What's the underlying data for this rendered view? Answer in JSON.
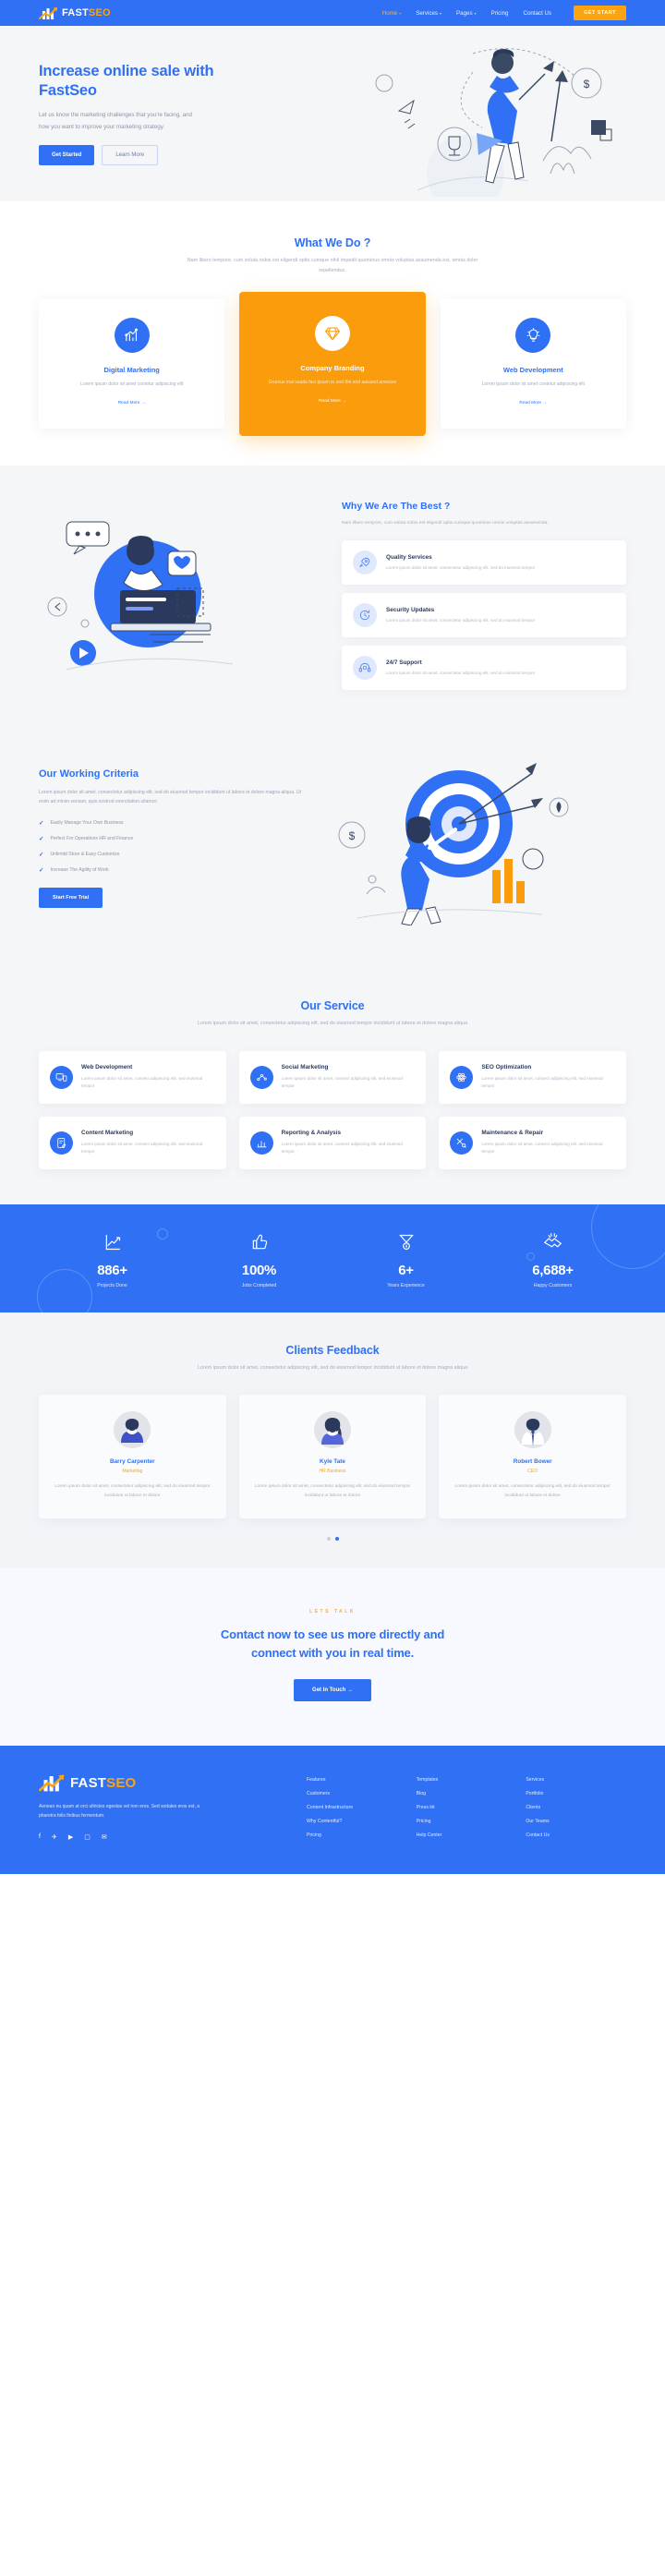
{
  "brand": {
    "name_white": "FAST",
    "name_orange": "SEO",
    "logo_icon": "bar-chart-arrow-logo"
  },
  "header": {
    "nav": [
      {
        "label": "Home",
        "has_caret": true,
        "active": true
      },
      {
        "label": "Services",
        "has_caret": true,
        "active": false
      },
      {
        "label": "Pages",
        "has_caret": true,
        "active": false
      },
      {
        "label": "Pricing",
        "has_caret": false,
        "active": false
      },
      {
        "label": "Contact Us",
        "has_caret": false,
        "active": false
      }
    ],
    "cta_label": "GET START"
  },
  "hero": {
    "title": "Increase online sale with FastSeo",
    "subtitle": "Let us know the marketing challenges that you're facing, and how you want to improve your marketing strategy.",
    "primary_btn": "Get Started",
    "secondary_btn": "Learn More"
  },
  "whatwedo": {
    "title": "What We Do ?",
    "subtitle": "Nam libero tempore, cum soluta nobis est eligendi optio cumque nihil impedit quominus omnis voluptas assumenda est, omnis dolor repellendus.",
    "cards": [
      {
        "icon": "bar-chart-icon",
        "title": "Digital Marketing",
        "desc": "Lorem ipsum dolor sit amet contetur adipiscing elit",
        "more": "Read More",
        "featured": false
      },
      {
        "icon": "diamond-icon",
        "title": "Company Branding",
        "desc": "Grurcus mal suada faci ipsum to and the and aaisand amesion",
        "more": "Read More",
        "featured": true
      },
      {
        "icon": "lightbulb-icon",
        "title": "Web Development",
        "desc": "Lorem ipsum dolor sit amet contetur adipiscing elit",
        "more": "Read More",
        "featured": false
      }
    ]
  },
  "whybest": {
    "title": "Why We Are The Best ?",
    "subtitle": "Nam libero tempore, cum soluta nobis est eligendi optio cumque quominus omnis voluptas assumenda.",
    "items": [
      {
        "icon": "rocket-icon",
        "title": "Quality Services",
        "desc": "Lorem ipsum dolor sit amet, consectetur adipiscing elit, sed do eiusmod tempor"
      },
      {
        "icon": "shield-refresh-icon",
        "title": "Security Updates",
        "desc": "Lorem ipsum dolor sit amet, consectetur adipiscing elit, sed do eiusmod tempor"
      },
      {
        "icon": "headset-support-icon",
        "title": "24/7 Support",
        "desc": "Lorem ipsum dolor sit amet, consectetur adipiscing elit, sed do eiusmod tempor"
      }
    ]
  },
  "criteria": {
    "title": "Our Working Criteria",
    "paragraph": "Lorem ipsum dolor sit amet, consectetur adipiscing elit, sed do eiusmod tempor incididunt ut labore et dolore magna aliqua. Ut enim ad minim veniam, quis nostrud exercitation ullamco",
    "bullets": [
      "Easily Manage Your Own Business",
      "Perfect For Operations HR and Finance",
      "Unlimitd Store & Easy Customize",
      "Increase The Agility of Work"
    ],
    "button": "Start Free Trial"
  },
  "ourservice": {
    "title": "Our Service",
    "subtitle": "Lorem ipsum dolor sit amet, consectetur adipiscing elit, sed do eiusmod tempor incididunt ut labore et dolore magna aliqua",
    "cards": [
      {
        "icon": "devices-icon",
        "title": "Web Development",
        "desc": "Lorem ipsum dolor sit amet, consect adipiscing elit, sed eiusmod tempor"
      },
      {
        "icon": "share-network-icon",
        "title": "Social Marketing",
        "desc": "Lorem ipsum dolor sit amet, consect adipiscing elit, sed eiusmod tempor"
      },
      {
        "icon": "atom-icon",
        "title": "SEO Optimization",
        "desc": "Lorem ipsum dolor sit amet, consect adipiscing elit, sed eiusmod tempor"
      },
      {
        "icon": "document-edit-icon",
        "title": "Content Marketing",
        "desc": "Lorem ipsum dolor sit amet, consect adipiscing elit, sed eiusmod tempor"
      },
      {
        "icon": "bar-report-icon",
        "title": "Reporting & Analysis",
        "desc": "Lorem ipsum dolor sit amet, consect adipiscing elit, sed eiusmod tempor"
      },
      {
        "icon": "tools-icon",
        "title": "Maintenance & Repair",
        "desc": "Lorem ipsum dolor sit amet, consect adipiscing elit, sed eiusmod tempor"
      }
    ]
  },
  "stats": [
    {
      "icon": "growth-chart-icon",
      "value": "886+",
      "label": "Projects Done"
    },
    {
      "icon": "thumbs-up-icon",
      "value": "100%",
      "label": "Jobs Completed"
    },
    {
      "icon": "medal-icon",
      "value": "6+",
      "label": "Years Experience"
    },
    {
      "icon": "handshake-icon",
      "value": "6,688+",
      "label": "Happy Customers"
    }
  ],
  "feedback": {
    "title": "Clients Feedback",
    "subtitle": "Lorem ipsum dolor sit amet, consectetur adipiscing elit, sed do eiusmod tempor incididunt ut labore et dolore magna aliqua",
    "cards": [
      {
        "avatar": "avatar-male-short-hair",
        "name": "Barry Carpenter",
        "role": "Marketing",
        "text": "Lorem ipsum dolor sit amet, consectetur adipiscing elit, sed do eiusmod tempor incididunt ut labore et dolore"
      },
      {
        "avatar": "avatar-female-ponytail",
        "name": "Kyle Tate",
        "role": "HR Business",
        "text": "Lorem ipsum dolor sit amet, consectetur adipiscing elit, sed do eiusmod tempor incididunt ut labore et dolore"
      },
      {
        "avatar": "avatar-male-tie",
        "name": "Robert Bower",
        "role": "CEO",
        "text": "Lorem ipsum dolor sit amet, consectetur adipiscing elit, sed do eiusmod tempor incididunt ut labore et dolore"
      }
    ],
    "dots": 2,
    "active_dot": 1
  },
  "cta": {
    "eyebrow": "LETS TALK",
    "title_line1": "Contact now to see us more directly and",
    "title_line2": "connect with you in real time.",
    "button": "Get In Touch"
  },
  "footer": {
    "description": "Aenean eu quam at orci ultricies egestas vel non eros. Sed sodales eros est, a pharetra felis finibus fermentum.",
    "social": [
      {
        "icon": "facebook-icon",
        "glyph": "f"
      },
      {
        "icon": "twitter-icon",
        "glyph": "✈"
      },
      {
        "icon": "youtube-icon",
        "glyph": "▶"
      },
      {
        "icon": "instagram-icon",
        "glyph": "▢"
      },
      {
        "icon": "email-icon",
        "glyph": "✉"
      }
    ],
    "columns": [
      {
        "links": [
          "Features",
          "Customers",
          "Content Infrastructure",
          "Why Contentful?",
          "Pricing"
        ]
      },
      {
        "links": [
          "Templates",
          "Blog",
          "Press kit",
          "Pricing",
          "Help Center"
        ]
      },
      {
        "links": [
          "Services",
          "Portfolio",
          "Clients",
          "Our Teams",
          "Contact Us"
        ]
      }
    ]
  },
  "colors": {
    "brand_blue": "#2f70f5",
    "brand_orange": "#fca311",
    "card_orange": "#fb9c0c",
    "bg_grey": "#f5f6f8"
  }
}
